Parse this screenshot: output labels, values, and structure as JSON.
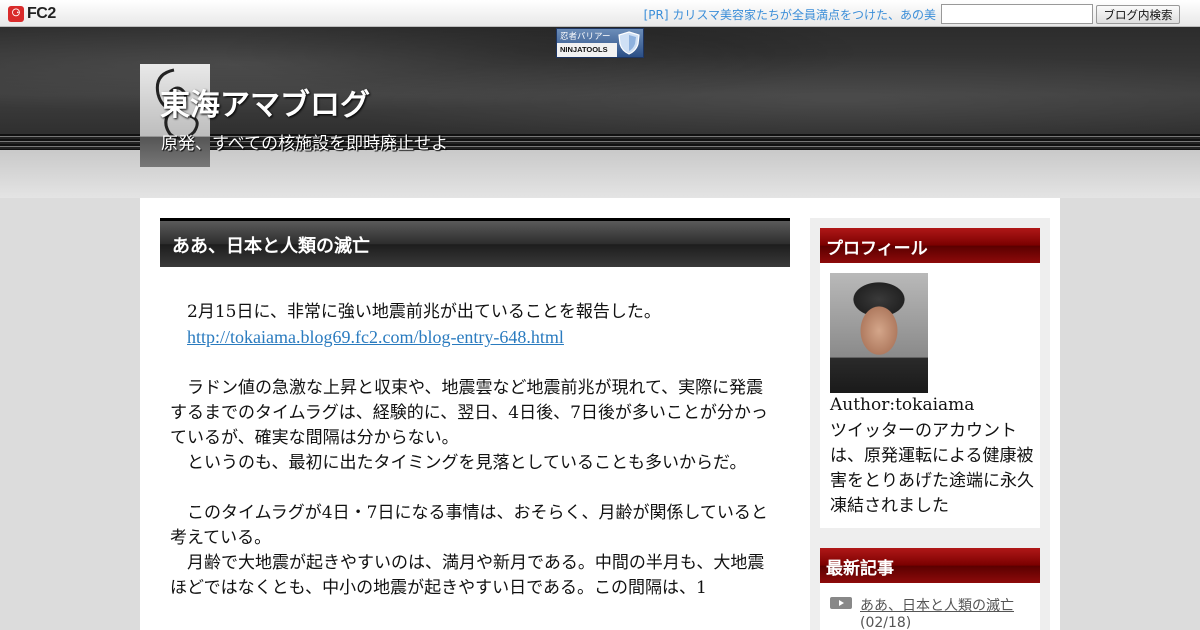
{
  "topbar": {
    "logo_mark": "⚆",
    "logo_text": "FC2",
    "pr_link": "[PR] カリスマ美容家たちが全員満点をつけた、あの美",
    "search_placeholder": "",
    "search_button": "ブログ内検索"
  },
  "ninja": {
    "top_text": "忍者バリアー",
    "bottom_text": "NINJATOOLS"
  },
  "header": {
    "title": "東海アマブログ",
    "subtitle": "原発、すべての核施設を即時廃止せよ"
  },
  "entry": {
    "title": "ああ、日本と人類の滅亡",
    "lines": [
      "　2月15日に、非常に強い地震前兆が出ていることを報告した。",
      "　http://tokaiama.blog69.fc2.com/blog-entry-648.html",
      "",
      "　ラドン値の急激な上昇と収束や、地震雲など地震前兆が現れて、実際に発震するまでのタイムラグは、経験的に、翌日、4日後、7日後が多いことが分かっているが、確実な間隔は分からない。",
      "　というのも、最初に出たタイミングを見落としていることも多いからだ。",
      "",
      "　このタイムラグが4日・7日になる事情は、おそらく、月齢が関係していると考えている。",
      "　月齢で大地震が起きやすいのは、満月や新月である。中間の半月も、大地震ほどではなくとも、中小の地震が起きやすい日である。この間隔は、1"
    ],
    "link": "http://tokaiama.blog69.fc2.com/blog-entry-648.html"
  },
  "sidebar": {
    "profile_heading": "プロフィール",
    "author": "Author:tokaiama",
    "profile_desc": "ツイッターのアカウントは、原発運転による健康被害をとりあげた途端に永久凍結されました",
    "recent_heading": "最新記事",
    "recent_items": [
      {
        "title": "ああ、日本と人類の滅亡",
        "date": "(02/18)"
      }
    ]
  }
}
